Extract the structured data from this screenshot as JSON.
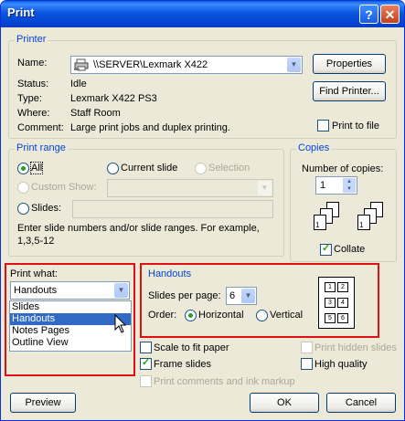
{
  "window": {
    "title": "Print",
    "help_btn": "?",
    "close_btn": "✕"
  },
  "printer": {
    "legend": "Printer",
    "name_label": "Name:",
    "name_value": "\\\\SERVER\\Lexmark X422",
    "status_label": "Status:",
    "status_value": "Idle",
    "type_label": "Type:",
    "type_value": "Lexmark X422 PS3",
    "where_label": "Where:",
    "where_value": "Staff Room",
    "comment_label": "Comment:",
    "comment_value": "Large print jobs and duplex printing.",
    "properties_btn": "Properties",
    "find_printer_btn": "Find Printer...",
    "print_to_file": "Print to file"
  },
  "print_range": {
    "legend": "Print range",
    "all": "All",
    "current_slide": "Current slide",
    "selection": "Selection",
    "custom_show": "Custom Show:",
    "slides": "Slides:",
    "hint": "Enter slide numbers and/or slide ranges. For example,",
    "hint_example": "1,3,5-12"
  },
  "copies": {
    "legend": "Copies",
    "number_label": "Number of copies:",
    "number_value": "1",
    "collate": "Collate"
  },
  "print_what": {
    "label": "Print what:",
    "selected": "Handouts",
    "options": [
      "Slides",
      "Handouts",
      "Notes Pages",
      "Outline View"
    ]
  },
  "handouts": {
    "legend": "Handouts",
    "slides_per_page_label": "Slides per page:",
    "slides_per_page_value": "6",
    "order_label": "Order:",
    "horizontal": "Horizontal",
    "vertical": "Vertical",
    "preview_numbers": [
      "1",
      "2",
      "3",
      "4",
      "5",
      "6"
    ]
  },
  "options": {
    "scale_to_fit": "Scale to fit paper",
    "frame_slides": "Frame slides",
    "print_comments": "Print comments and ink markup",
    "print_hidden": "Print hidden slides",
    "high_quality": "High quality"
  },
  "buttons": {
    "preview": "Preview",
    "ok": "OK",
    "cancel": "Cancel"
  }
}
